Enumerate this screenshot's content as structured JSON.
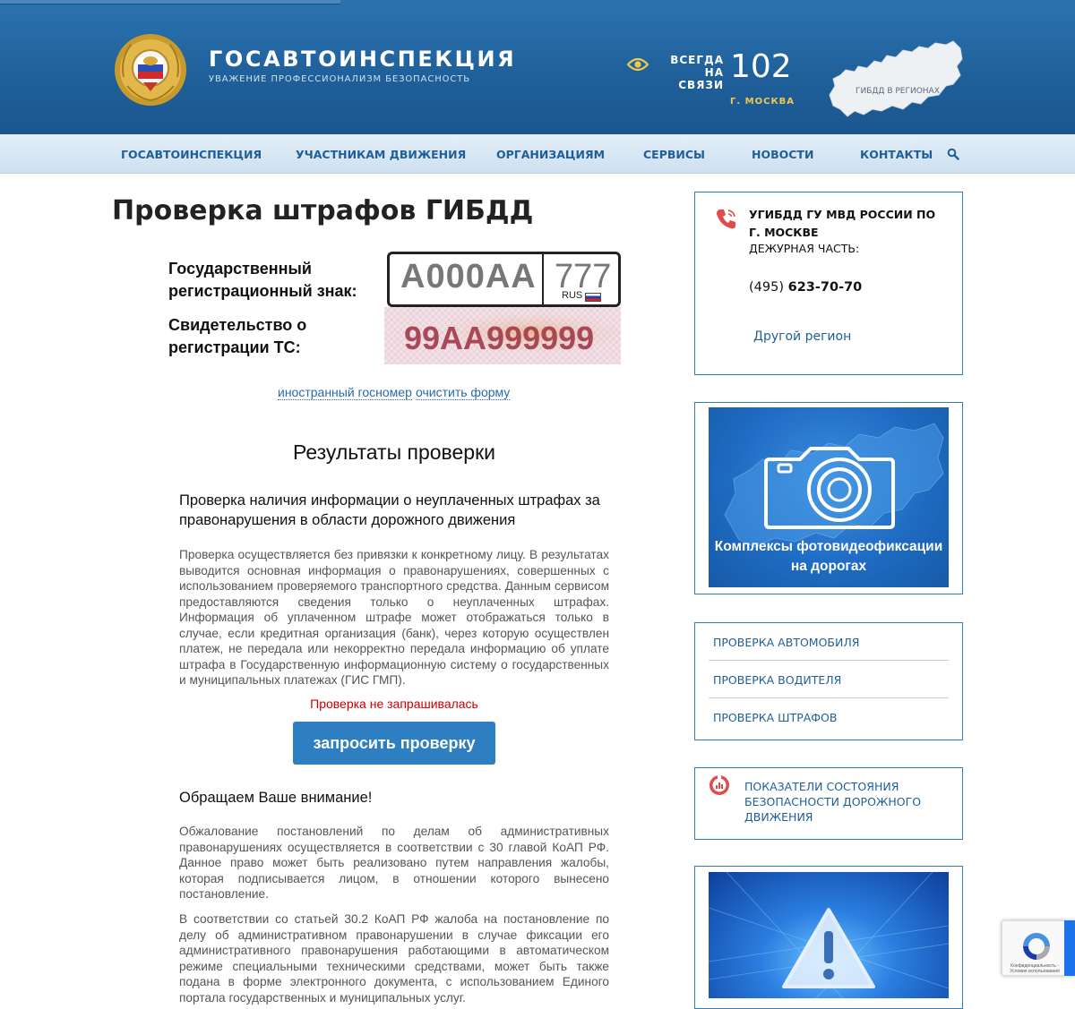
{
  "header": {
    "title": "ГОСАВТОИНСПЕКЦИЯ",
    "subtitle": "УВАЖЕНИЕ ПРОФЕССИОНАЛИЗМ БЕЗОПАСНОСТЬ",
    "always_line1": "ВСЕГДА",
    "always_line2": "НА СВЯЗИ",
    "phone": "102",
    "city": "Г. МОСКВА",
    "regions_label": "ГИБДД В РЕГИОНАХ",
    "icons": [
      "emblem-icon",
      "eye-icon",
      "russia-map-icon"
    ]
  },
  "nav": {
    "items": [
      "ГОСАВТОИНСПЕКЦИЯ",
      "УЧАСТНИКАМ ДВИЖЕНИЯ",
      "ОРГАНИЗАЦИЯМ",
      "СЕРВИСЫ",
      "НОВОСТИ",
      "КОНТАКТЫ"
    ],
    "search_icon": "search-icon"
  },
  "main": {
    "title": "Проверка штрафов ГИБДД",
    "reg_plate_label_line1": "Государственный",
    "reg_plate_label_line2": "регистрационный знак:",
    "plate_number_placeholder": "А000АА",
    "plate_region_placeholder": "777",
    "plate_country": "RUS",
    "sts_label_line1": "Свидетельство о",
    "sts_label_line2": "регистрации ТС:",
    "sts_placeholder": "99АА999999",
    "foreign_plate_link": "иностранный госномер",
    "clear_form_link": "очистить форму",
    "results_title": "Результаты проверки",
    "check_section_title": "Проверка наличия информации о неуплаченных штрафах за правонарушения в области дорожного движения",
    "check_description": "Проверка осуществляется без привязки к конкретному лицу. В результатах выводится основная информация о правонарушениях, совершенных с использованием проверяемого транспортного средства. Данным сервисом предоставляются сведения только о неуплаченных штрафах. Информация об уплаченном штрафе может отображаться только в случае, если кредитная организация (банк), через которую осуществлен платеж, не передала или некорректно передала информацию об уплате штрафа в Государственную информационную систему о государственных и муниципальных платежах (ГИС ГМП).",
    "check_status": "Проверка не запрашивалась",
    "request_button": "запросить проверку",
    "attention_title": "Обращаем Ваше внимание!",
    "attention_p1": "Обжалование постановлений по делам об административных правонарушениях осуществляется в соответствии с 30 главой КоАП РФ. Данное право может быть реализовано путем направления жалобы, которая подписывается лицом, в отношении которого вынесено постановление.",
    "attention_p2": "В соответствии со статьей 30.2 КоАП РФ жалоба на постановление по делу об административном правонарушении в случае фиксации его административного правонарушения работающими в автоматическом режиме специальными техническими средствами, может быть также подана в форме электронного документа, с использованием Единого портала государственных и муниципальных услуг."
  },
  "sidebar": {
    "contact": {
      "org": "УГИБДД ГУ МВД РОССИИ ПО Г. МОСКВЕ",
      "duty_label": "ДЕЖУРНАЯ ЧАСТЬ:",
      "phone_code": "(495)",
      "phone_number": "623-70-70",
      "other_region": "Другой регион",
      "icon": "phone-icon"
    },
    "banner_camera": {
      "line1": "Комплексы фотовидеофиксации",
      "line2": "на дорогах",
      "icon": "camera-icon"
    },
    "check_links": [
      "ПРОВЕРКА АВТОМОБИЛЯ",
      "ПРОВЕРКА ВОДИТЕЛЯ",
      "ПРОВЕРКА ШТРАФОВ"
    ],
    "stats_link": "ПОКАЗАТЕЛИ СОСТОЯНИЯ БЕЗОПАСНОСТИ ДОРОЖНОГО ДВИЖЕНИЯ",
    "stats_icon": "chart-icon",
    "banner_warning_icon": "warning-icon"
  },
  "recaptcha": {
    "text": "Конфиденциальность - Условия использования"
  },
  "colors": {
    "header_blue": "#1f5f99",
    "link_blue": "#1f5f99",
    "button_blue": "#2d7fc2",
    "status_red": "#cc0000",
    "city_gold": "#f2c94c"
  }
}
